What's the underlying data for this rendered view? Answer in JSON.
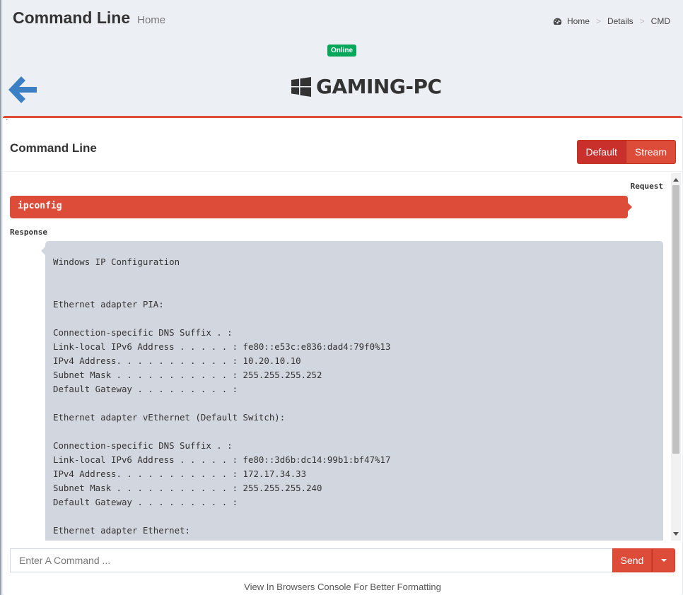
{
  "header": {
    "title": "Command Line",
    "subtitle": "Home",
    "breadcrumb": {
      "items": [
        "Home",
        "Details",
        "CMD"
      ],
      "separator": ">"
    }
  },
  "device": {
    "status": "Online",
    "status_color": "#00a65a",
    "name": "GAMING-PC",
    "os_icon": "windows-icon"
  },
  "panel": {
    "tick": "`",
    "title": "Command Line",
    "mode_buttons": {
      "default_label": "Default",
      "stream_label": "Stream"
    },
    "accent_color": "#dd4b39"
  },
  "conversation": {
    "request_label": "Request",
    "request_command": "ipconfig",
    "response_label": "Response",
    "response_lines": [
      "Windows IP Configuration",
      "",
      "",
      "Ethernet adapter PIA:",
      "",
      "Connection-specific DNS Suffix . :",
      "Link-local IPv6 Address . . . . . : fe80::e53c:e836:dad4:79f0%13",
      "IPv4 Address. . . . . . . . . . . : 10.20.10.10",
      "Subnet Mask . . . . . . . . . . . : 255.255.255.252",
      "Default Gateway . . . . . . . . . :",
      "",
      "Ethernet adapter vEthernet (Default Switch):",
      "",
      "Connection-specific DNS Suffix . :",
      "Link-local IPv6 Address . . . . . : fe80::3d6b:dc14:99b1:bf47%17",
      "IPv4 Address. . . . . . . . . . . : 172.17.34.33",
      "Subnet Mask . . . . . . . . . . . : 255.255.255.240",
      "Default Gateway . . . . . . . . . :",
      "",
      "Ethernet adapter Ethernet:"
    ]
  },
  "input": {
    "placeholder": "Enter A Command ...",
    "value": "",
    "send_label": "Send"
  },
  "footer": {
    "note": "View In Browsers Console For Better Formatting"
  }
}
